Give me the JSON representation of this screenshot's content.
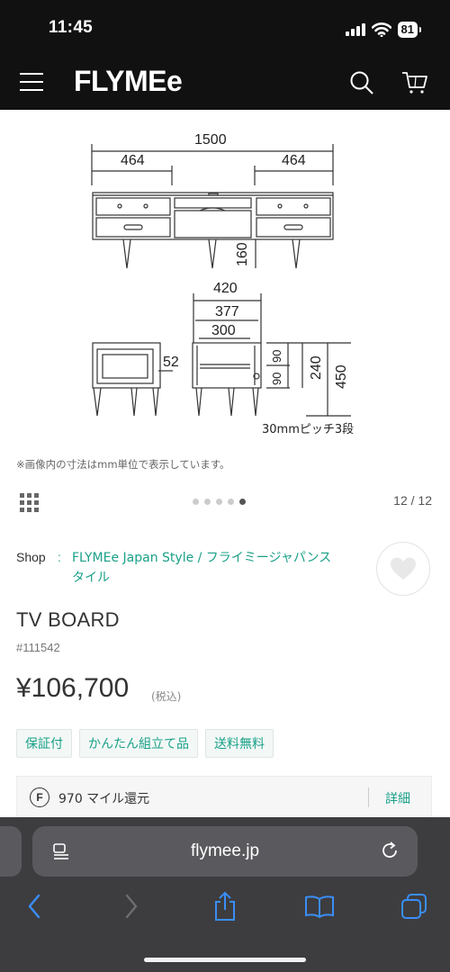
{
  "status_bar": {
    "time": "11:45",
    "battery": "81"
  },
  "nav": {
    "brand": "FLYMEe",
    "menu_icon": "hamburger-menu-icon",
    "search_icon": "search-icon",
    "cart_icon": "cart-icon"
  },
  "product_image": {
    "front_width": "1500",
    "left_drawer_width": "464",
    "right_drawer_width": "464",
    "leg_height": "160",
    "depth": "420",
    "inner_depth": "377",
    "shelf_depth": "300",
    "side_offset": "52",
    "shelf_h1": "90",
    "shelf_h2": "90",
    "inner_height": "240",
    "total_height": "450",
    "pitch_note": "30mmピッチ3段"
  },
  "dimension_note": "※画像内の寸法はmm単位で表示しています。",
  "gallery": {
    "page_counter": "12 / 12",
    "total_dots": 5,
    "active_dot": 5
  },
  "shop": {
    "label": "Shop",
    "separator": ":",
    "name": "FLYMEe Japan Style / フライミージャパンスタイル"
  },
  "product": {
    "title": "TV BOARD",
    "id": "#111542",
    "price": "¥106,700",
    "tax_note": "(税込)"
  },
  "tags": [
    "保証付",
    "かんたん組立て品",
    "送料無料"
  ],
  "miles": {
    "icon_letter": "F",
    "text": "970 マイル還元",
    "detail_link": "詳細"
  },
  "safari": {
    "url": "flymee.jp"
  },
  "colors": {
    "accent": "#1aa088",
    "nav_bg": "#111111",
    "safari_bg": "#3d3d40",
    "link_blue": "#3a8ef6"
  }
}
